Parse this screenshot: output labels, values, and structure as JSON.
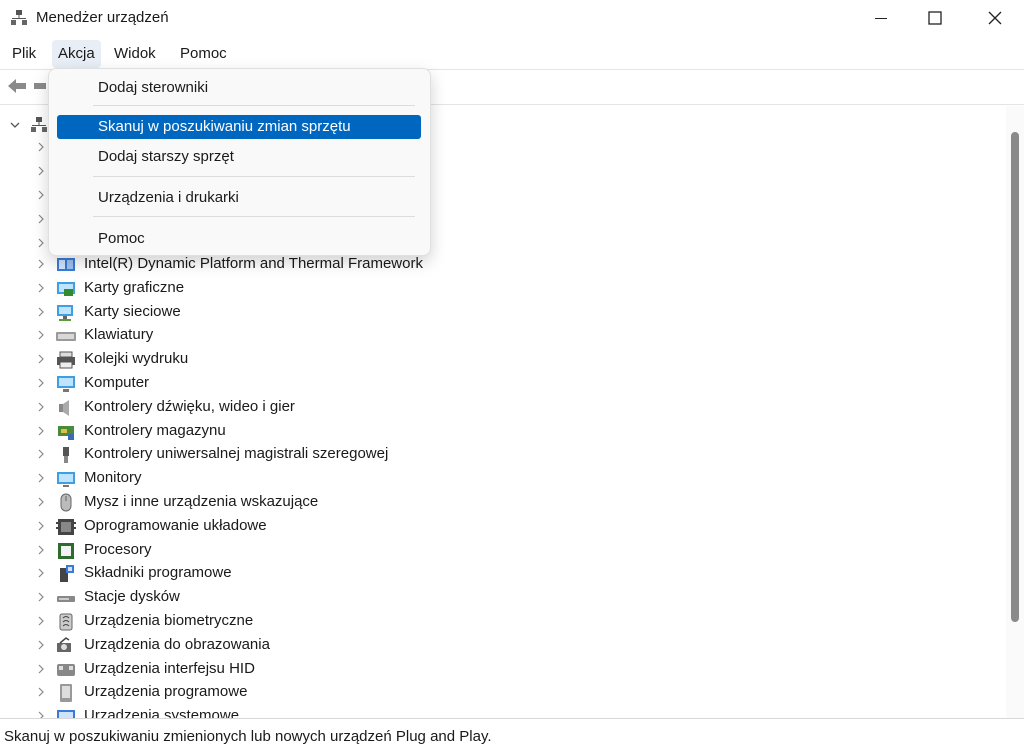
{
  "window": {
    "title": "Menedżer urządzeń"
  },
  "menubar": {
    "file": "Plik",
    "action": "Akcja",
    "view": "Widok",
    "help": "Pomoc"
  },
  "dropdown": {
    "items": [
      {
        "label": "Dodaj sterowniki"
      },
      {
        "label": "Skanuj w poszukiwaniu zmian sprzętu",
        "highlighted": true
      },
      {
        "label": "Dodaj starszy sprzęt"
      },
      {
        "label": "Urządzenia i drukarki"
      },
      {
        "label": "Pomoc"
      }
    ]
  },
  "tree": {
    "categories": [
      {
        "label": "Intel(R) Dynamic Platform and Thermal Framework",
        "icon": "thermal-framework-icon"
      },
      {
        "label": "Karty graficzne",
        "icon": "display-adapter-icon"
      },
      {
        "label": "Karty sieciowe",
        "icon": "network-adapter-icon"
      },
      {
        "label": "Klawiatury",
        "icon": "keyboard-icon"
      },
      {
        "label": "Kolejki wydruku",
        "icon": "printer-icon"
      },
      {
        "label": "Komputer",
        "icon": "computer-icon"
      },
      {
        "label": "Kontrolery dźwięku, wideo i gier",
        "icon": "speaker-icon"
      },
      {
        "label": "Kontrolery magazynu",
        "icon": "storage-controller-icon"
      },
      {
        "label": "Kontrolery uniwersalnej magistrali szeregowej",
        "icon": "usb-icon"
      },
      {
        "label": "Monitory",
        "icon": "monitor-icon"
      },
      {
        "label": "Mysz i inne urządzenia wskazujące",
        "icon": "mouse-icon"
      },
      {
        "label": "Oprogramowanie układowe",
        "icon": "firmware-icon"
      },
      {
        "label": "Procesory",
        "icon": "processor-icon"
      },
      {
        "label": "Składniki programowe",
        "icon": "software-component-icon"
      },
      {
        "label": "Stacje dysków",
        "icon": "disk-drive-icon"
      },
      {
        "label": "Urządzenia biometryczne",
        "icon": "biometric-icon"
      },
      {
        "label": "Urządzenia do obrazowania",
        "icon": "camera-icon"
      },
      {
        "label": "Urządzenia interfejsu HID",
        "icon": "hid-icon"
      },
      {
        "label": "Urządzenia programowe",
        "icon": "software-device-icon"
      },
      {
        "label": "Urządzenia systemowe",
        "icon": "system-device-icon"
      }
    ]
  },
  "statusbar": {
    "text": "Skanuj w poszukiwaniu zmienionych lub nowych urządzeń Plug and Play."
  },
  "colors": {
    "accent": "#0067c0",
    "scrollbar_thumb": "#8a8a8a"
  }
}
